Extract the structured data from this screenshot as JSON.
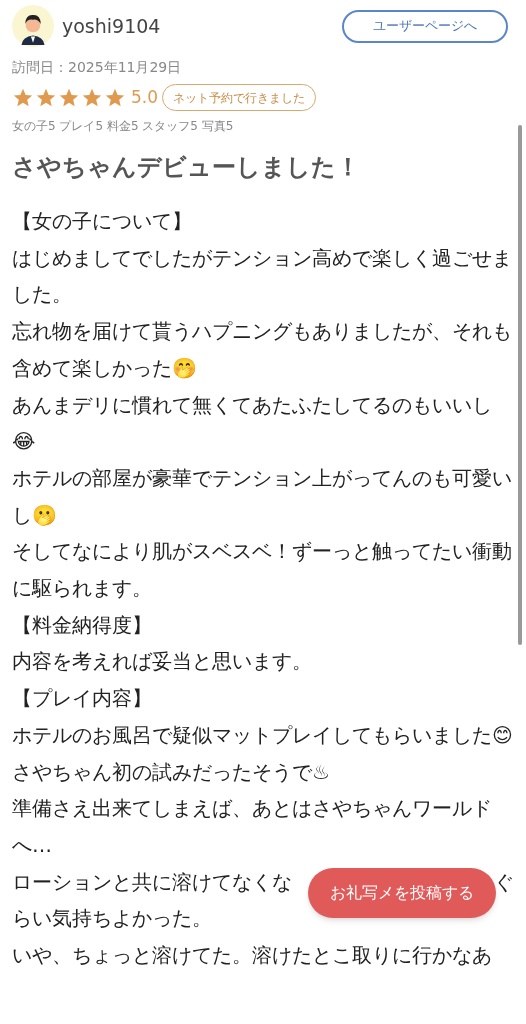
{
  "user": {
    "name": "yoshi9104",
    "button": "ユーザーページへ"
  },
  "visit_date": "訪問日：2025年11月29日",
  "rating": {
    "stars": 5,
    "score": "5.0",
    "badge": "ネット予約で行きました"
  },
  "sub_scores": "女の子5 プレイ5 料金5 スタッフ5 写真5",
  "title": "さやちゃんデビューしました！",
  "body": [
    {
      "text": "【女の子について】"
    },
    {
      "text": "はじめましてでしたがテンション高めで楽しく過ごせました。"
    },
    {
      "text": "忘れ物を届けて貰うハプニングもありましたが、それも含めて楽しかった🤭"
    },
    {
      "text": "あんまデリに慣れて無くてあたふたしてるのもいいし😂"
    },
    {
      "text": "ホテルの部屋が豪華でテンション上がってんのも可愛いし🫢"
    },
    {
      "text": "そしてなにより肌がスベスベ！ずーっと触ってたい衝動に駆られます。"
    },
    {
      "text": "【料金納得度】"
    },
    {
      "text": "内容を考えれば妥当と思います。"
    },
    {
      "text": "【プレイ内容】"
    },
    {
      "text": "ホテルのお風呂で疑似マットプレイしてもらいました😊"
    },
    {
      "text": "さやちゃん初の試みだったそうで♨"
    },
    {
      "text": "準備さえ出来てしまえば、あとはさやちゃんワールドへ…"
    },
    {
      "parts": [
        "ローションと共に溶けてなくな",
        "ぐ"
      ]
    },
    {
      "text": "らい気持ちよかった。"
    },
    {
      "text": "いや、ちょっと溶けてた。溶けたとこ取りに行かなあ"
    }
  ],
  "post_button": "お礼写メを投稿する"
}
